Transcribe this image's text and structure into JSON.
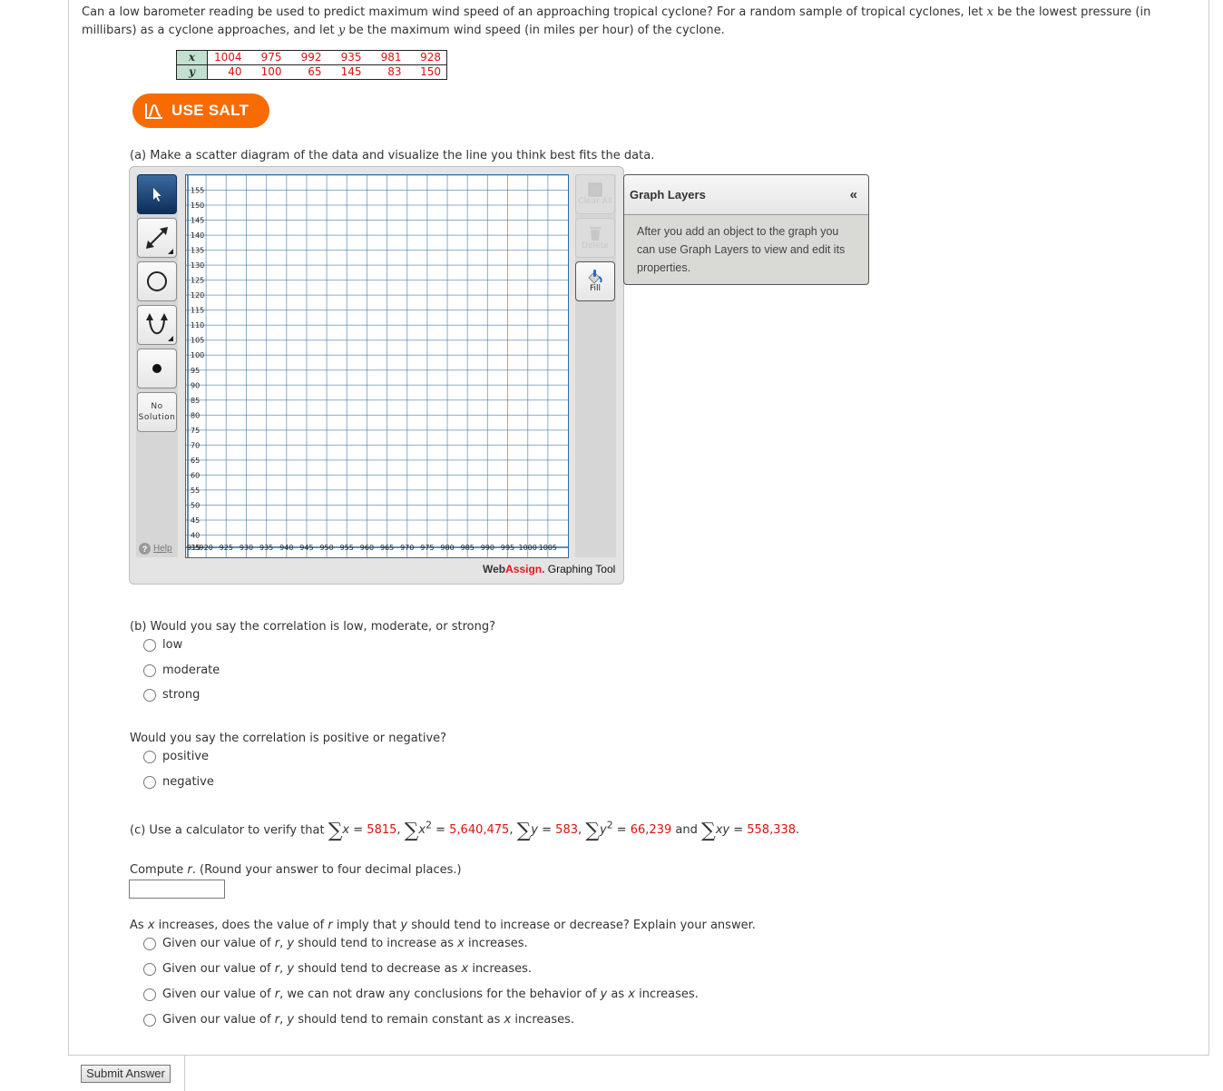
{
  "intro": {
    "text_1": "Can a low barometer reading be used to predict maximum wind speed of an approaching tropical cyclone? For a random sample of tropical cyclones, let ",
    "var_x": "x",
    "text_2": " be the lowest pressure (in millibars) as a cyclone approaches, and let ",
    "var_y": "y",
    "text_3": " be the maximum wind speed (in miles per hour) of the cyclone."
  },
  "data_table": {
    "x_label": "x",
    "y_label": "y",
    "x_values": [
      "1004",
      "975",
      "992",
      "935",
      "981",
      "928"
    ],
    "y_values": [
      "40",
      "100",
      "65",
      "145",
      "83",
      "150"
    ]
  },
  "salt_button": {
    "label": "USE SALT",
    "icon": "distribution-curve-icon",
    "color": "#f76b00"
  },
  "part_a": {
    "prompt": "(a) Make a scatter diagram of the data and visualize the line you think best fits the data."
  },
  "graph_tool": {
    "tools": [
      {
        "name": "pointer",
        "icon": "arrow-cursor-icon",
        "selected": true
      },
      {
        "name": "line",
        "icon": "double-arrow-line-icon",
        "selected": false
      },
      {
        "name": "circle",
        "icon": "circle-icon",
        "selected": false
      },
      {
        "name": "parabola",
        "icon": "parabola-icon",
        "selected": false
      },
      {
        "name": "point",
        "icon": "point-icon",
        "selected": false
      },
      {
        "name": "no-solution",
        "label_1": "No",
        "label_2": "Solution",
        "selected": false
      }
    ],
    "help_label": "Help",
    "actions": {
      "clear_all": "Clear All",
      "delete": "Delete",
      "fill": "Fill"
    },
    "brand_web": "Web",
    "brand_assign": "Assign.",
    "brand_suffix": " Graphing Tool",
    "axis": {
      "x_origin_label": "915",
      "y_origin_label": "35",
      "x_ticks": [
        "920",
        "925",
        "930",
        "935",
        "940",
        "945",
        "950",
        "955",
        "960",
        "965",
        "970",
        "975",
        "980",
        "985",
        "990",
        "995",
        "1000",
        "1005"
      ],
      "y_ticks": [
        "40",
        "45",
        "50",
        "55",
        "60",
        "65",
        "70",
        "75",
        "80",
        "85",
        "90",
        "95",
        "100",
        "105",
        "110",
        "115",
        "120",
        "125",
        "130",
        "135",
        "140",
        "145",
        "150",
        "155"
      ],
      "x_range": [
        915,
        1010
      ],
      "y_range": [
        35,
        160
      ]
    },
    "colors": {
      "grid": "#2d6b9c",
      "selected_tool": "#1d4577"
    }
  },
  "graph_layers": {
    "title": "Graph Layers",
    "collapse_label": "«",
    "body": "After you add an object to the graph you can use Graph Layers to view and edit its properties."
  },
  "part_b": {
    "prompt_1": "(b) Would you say the correlation is low, moderate, or strong?",
    "options_1": [
      "low",
      "moderate",
      "strong"
    ],
    "prompt_2": "Would you say the correlation is positive or negative?",
    "options_2": [
      "positive",
      "negative"
    ]
  },
  "part_c": {
    "prompt_prefix": "(c) Use a calculator to verify that ",
    "sums": [
      {
        "expr": "x",
        "sup": "",
        "value": "5815",
        "sep": ", "
      },
      {
        "expr": "x",
        "sup": "2",
        "value": "5,640,475",
        "sep": ", "
      },
      {
        "expr": "y",
        "sup": "",
        "value": "583",
        "sep": ", "
      },
      {
        "expr": "y",
        "sup": "2",
        "value": "66,239",
        "sep": " and "
      },
      {
        "expr": "xy",
        "sup": "",
        "value": "558,338",
        "sep": "."
      }
    ],
    "compute_prefix": "Compute ",
    "compute_var": "r",
    "compute_suffix": ". (Round your answer to four decimal places.)",
    "r_answer_value": "",
    "explain_prompt": {
      "p1": "As ",
      "x": "x",
      "p2": " increases, does the value of ",
      "r": "r",
      "p3": " imply that ",
      "y": "y",
      "p4": " should tend to increase or decrease? Explain your answer."
    },
    "explain_options": [
      {
        "a": "Given our value of ",
        "r": "r",
        "b": ", ",
        "y": "y",
        "c": " should tend to increase as ",
        "x": "x",
        "d": " increases."
      },
      {
        "a": "Given our value of ",
        "r": "r",
        "b": ", ",
        "y": "y",
        "c": " should tend to decrease as ",
        "x": "x",
        "d": " increases."
      },
      {
        "a": "Given our value of ",
        "r": "r",
        "b": ", we can not draw any conclusions for the behavior of ",
        "y": "y",
        "c": " as ",
        "x": "x",
        "d": " increases."
      },
      {
        "a": "Given our value of ",
        "r": "r",
        "b": ", ",
        "y": "y",
        "c": " should tend to remain constant as ",
        "x": "x",
        "d": " increases."
      }
    ]
  },
  "submit_label": "Submit Answer"
}
